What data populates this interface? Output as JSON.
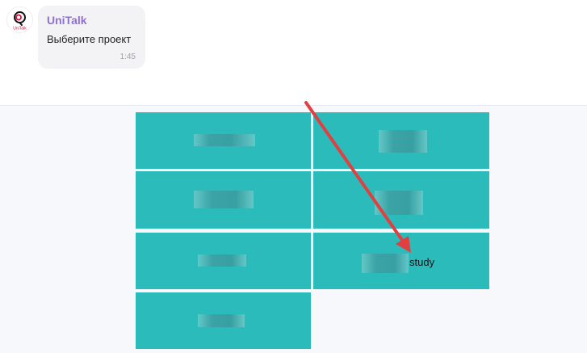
{
  "message": {
    "sender": "UniTalk",
    "avatar_text": "UniTalk",
    "text": "Выберите проект",
    "time": "1:45"
  },
  "keyboard": {
    "buttons": [
      {
        "label": ""
      },
      {
        "label": ""
      },
      {
        "label": ""
      },
      {
        "label": ""
      },
      {
        "label": ""
      },
      {
        "label": "study"
      },
      {
        "label": ""
      }
    ]
  },
  "colors": {
    "accent": "#8f6fd8",
    "button": "#2cbbbb",
    "annotation_arrow": "#e04040"
  },
  "icons": {
    "avatar": "unitalk-logo-icon",
    "annotation": "red-arrow-annotation"
  }
}
